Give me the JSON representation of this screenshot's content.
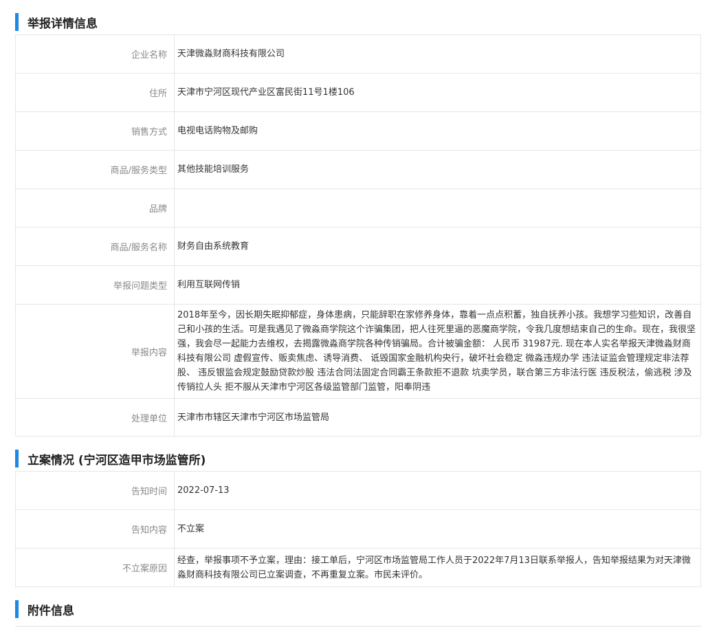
{
  "report": {
    "title": "举报详情信息",
    "rows": [
      {
        "label": "企业名称",
        "value": "天津微淼财商科技有限公司"
      },
      {
        "label": "住所",
        "value": "天津市宁河区现代产业区富民街11号1楼106"
      },
      {
        "label": "销售方式",
        "value": "电视电话购物及邮购"
      },
      {
        "label": "商品/服务类型",
        "value": "其他技能培训服务"
      },
      {
        "label": "品牌",
        "value": ""
      },
      {
        "label": "商品/服务名称",
        "value": "财务自由系统教育"
      },
      {
        "label": "举报问题类型",
        "value": "利用互联网传销"
      },
      {
        "label": "举报内容",
        "value": "2018年至今，因长期失眠抑郁症，身体患病，只能辞职在家修养身体，靠着一点点积蓄，独自抚养小孩。我想学习些知识，改善自己和小孩的生活。可是我遇见了微淼商学院这个诈骗集团，把人往死里逼的恶魔商学院，令我几度想结束自己的生命。现在，我很坚强，我会尽一起能力去维权，去揭露微淼商学院各种传销骗局。合计被骗金额： 人民币 31987元. 现在本人实名举报天津微淼财商科技有限公司 虚假宣传、贩卖焦虑、诱导消费、 诋毁国家金融机构央行，破坏社会稳定 微淼违规办学 违法证监会管理规定非法荐股、 违反银监会规定鼓励贷款炒股 违法合同法固定合同霸王条款拒不退款 坑卖学员，联合第三方非法行医 违反税法，偷逃税 涉及传销拉人头 拒不服从天津市宁河区各级监管部门监管，阳奉阴违"
      },
      {
        "label": "处理单位",
        "value": "天津市市辖区天津市宁河区市场监管局"
      }
    ]
  },
  "filing": {
    "title": "立案情况 (宁河区造甲市场监管所)",
    "rows": [
      {
        "label": "告知时间",
        "value": "2022-07-13"
      },
      {
        "label": "告知内容",
        "value": "不立案"
      },
      {
        "label": "不立案原因",
        "value": "经查，举报事项不予立案，理由：接工单后，宁河区市场监管局工作人员于2022年7月13日联系举报人，告知举报结果为对天津微淼财商科技有限公司已立案调查，不再重复立案。市民未评价。"
      }
    ]
  },
  "attachments": {
    "title": "附件信息"
  },
  "colors": {
    "accent": "#1e88e5",
    "label": "#888888",
    "border": "#e6e6e6"
  }
}
